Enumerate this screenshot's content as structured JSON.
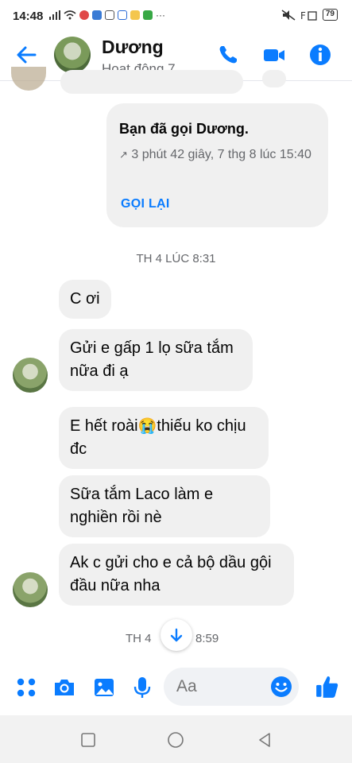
{
  "status_bar": {
    "time": "14:48",
    "battery": "79"
  },
  "header": {
    "name": "Dương",
    "status": "Hoạt động 7..."
  },
  "call_card": {
    "title": "Bạn đã gọi Dương.",
    "detail": "3 phút 42 giây, 7 thg 8 lúc 15:40",
    "action": "GỌI LẠI"
  },
  "timestamps": [
    "TH 4 LÚC 8:31",
    "TH 4",
    "8:59"
  ],
  "messages": [
    {
      "text": "C ơi"
    },
    {
      "text": "Gửi e gấp 1 lọ sữa tắm nữa đi ạ"
    },
    {
      "text": "E hết roài",
      "emoji": "😭",
      "text_after": "thiếu ko chịu đc"
    },
    {
      "text": "Sữa tắm Laco làm e nghiền rồi nè"
    },
    {
      "text": "Ak c gửi cho e cả bộ dầu gội đầu nữa nha"
    }
  ],
  "composer": {
    "placeholder": "Aa"
  },
  "colors": {
    "accent": "#0a7cff",
    "bubble": "#f0f0f0"
  },
  "icons": {
    "header": [
      "back-arrow-icon",
      "phone-icon",
      "video-camera-icon",
      "info-icon"
    ],
    "composer": [
      "menu-dots-icon",
      "camera-icon",
      "image-icon",
      "microphone-icon",
      "emoji-icon",
      "thumbs-up-icon"
    ]
  }
}
